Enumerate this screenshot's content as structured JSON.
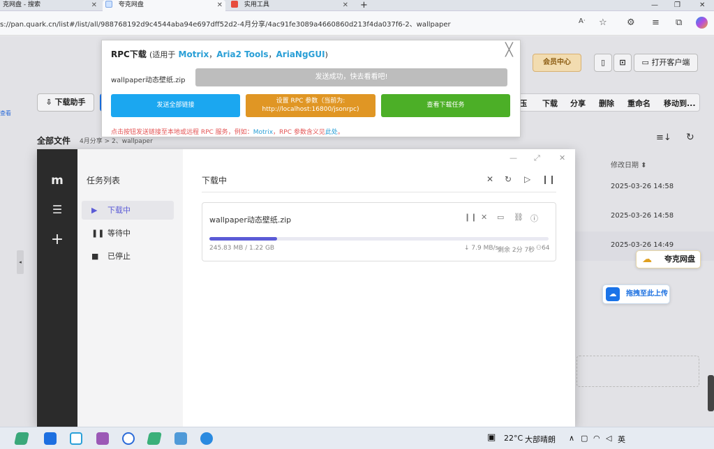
{
  "browser": {
    "tabs": [
      {
        "label": "克网盘 - 搜索"
      },
      {
        "label": "夸克网盘"
      },
      {
        "label": "实用工具"
      }
    ],
    "url": "s://pan.quark.cn/list#/list/all/988768192d9c4544aba94e697dff52d2-4月分享/4ac91fe3089a4660860d213f4da037f6-2、wallpaper"
  },
  "quark": {
    "member_center": "会员中心",
    "open_client": "打开客户端",
    "download_helper": "下载助手",
    "toolbar": [
      "压",
      "下载",
      "分享",
      "删除",
      "重命名",
      "移动到..."
    ],
    "breadcrumb_root": "全部文件",
    "breadcrumb_path": "4月分享 > 2、wallpaper",
    "modified_header": "修改日期",
    "dates": [
      "2025-03-26 14:58",
      "2025-03-26 14:58",
      "2025-03-26 14:49"
    ],
    "side_link": "查看",
    "float_brand": "夸克网盘",
    "float_upload": "拖拽至此上传"
  },
  "rpc": {
    "title": "RPC下载",
    "subtitle_prefix": "(适用于",
    "links": [
      "Motrix",
      "Aria2 Tools",
      "AriaNgGUI"
    ],
    "subtitle_suffix": ")",
    "file_name": "wallpaper动态壁纸.zip",
    "status": "发送成功，快去看看吧!",
    "btn_send_all": "发送全部链接",
    "btn_settings_line1": "设置 RPC 参数（当前为:",
    "btn_settings_line2": "http://localhost:16800/jsonrpc)",
    "btn_view": "查看下载任务",
    "hint_prefix": "点击按钮发送链接至本地或远程 RPC 服务，例如：",
    "hint_link1": "Motrix",
    "hint_mid": "，RPC 参数含义见",
    "hint_link2": "此处",
    "hint_suffix": "。",
    "colors": {
      "send_all": "#1ba7f0",
      "settings": "#e09624",
      "view": "#4caf27"
    }
  },
  "motrix": {
    "task_list_title": "任务列表",
    "nav": [
      {
        "label": "下载中",
        "icon": "play-icon"
      },
      {
        "label": "等待中",
        "icon": "pause-icon"
      },
      {
        "label": "已停止",
        "icon": "stop-icon"
      }
    ],
    "section_title": "下载中",
    "task": {
      "name": "wallpaper动态壁纸.zip",
      "progress": 0.2,
      "size": "245.83 MB / 1.22 GB",
      "speed": "↓ 7.9 MB/s",
      "remaining": "剩余 2分 7秒",
      "connections": "64"
    }
  },
  "taskbar": {
    "temperature": "22°C",
    "weather": "大部晴朗",
    "ime": "英"
  }
}
